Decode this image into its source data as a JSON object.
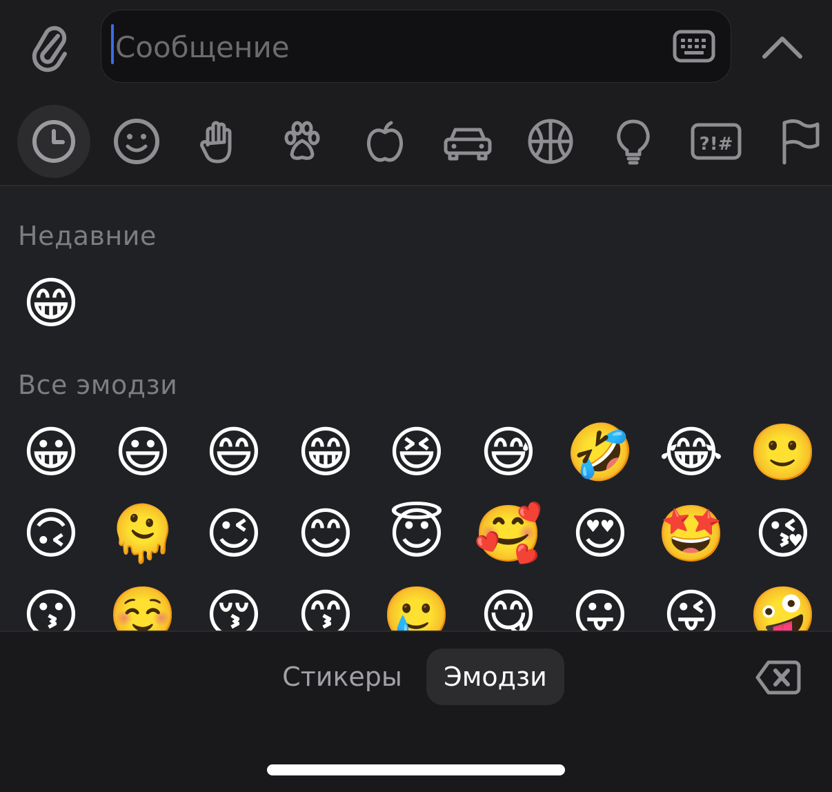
{
  "message_input": {
    "placeholder": "Сообщение",
    "value": ""
  },
  "categories": [
    {
      "icon": "clock-icon",
      "active": true
    },
    {
      "icon": "smiley-icon",
      "active": false
    },
    {
      "icon": "hand-icon",
      "active": false
    },
    {
      "icon": "paw-icon",
      "active": false
    },
    {
      "icon": "apple-icon",
      "active": false
    },
    {
      "icon": "car-icon",
      "active": false
    },
    {
      "icon": "basketball-icon",
      "active": false
    },
    {
      "icon": "lightbulb-icon",
      "active": false
    },
    {
      "icon": "symbols-icon",
      "active": false
    },
    {
      "icon": "flag-icon",
      "active": false
    }
  ],
  "sections": {
    "recent": {
      "title": "Недавние",
      "emojis": [
        "😁"
      ]
    },
    "all": {
      "title": "Все эмодзи",
      "emojis": [
        "😀",
        "😃",
        "😄",
        "😁",
        "😆",
        "😅",
        "🤣",
        "😂",
        "🙂",
        "🙃",
        "🫠",
        "😉",
        "😊",
        "😇",
        "🥰",
        "😍",
        "🤩",
        "😘",
        "😗",
        "☺️",
        "😚",
        "😙",
        "🥲",
        "😋",
        "😛",
        "😜",
        "🤪"
      ]
    }
  },
  "bottom_tabs": {
    "stickers": "Стикеры",
    "emoji": "Эмодзи"
  },
  "colors": {
    "accent": "#3a6ee8",
    "background": "#1c1c1e",
    "panel": "#202124"
  }
}
